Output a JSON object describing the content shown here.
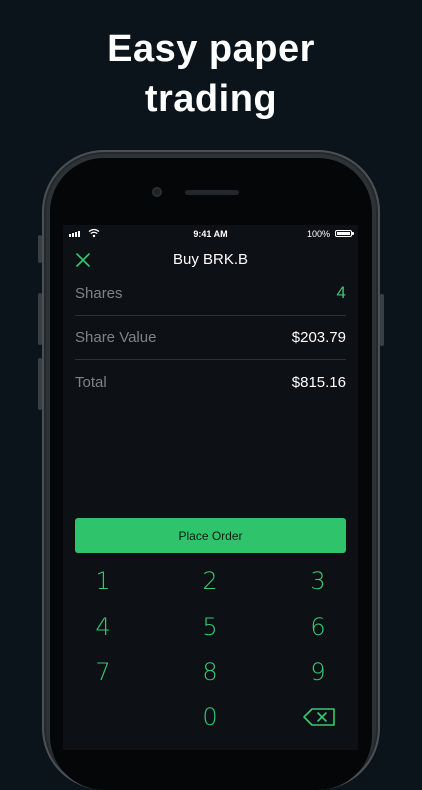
{
  "headline": {
    "line1": "Easy paper",
    "line2": "trading"
  },
  "status_bar": {
    "time": "9:41 AM",
    "battery": "100%"
  },
  "nav": {
    "title": "Buy BRK.B",
    "close_icon": "close-x-icon"
  },
  "order": {
    "rows": [
      {
        "label": "Shares",
        "value": "4"
      },
      {
        "label": "Share Value",
        "value": "$203.79"
      },
      {
        "label": "Total",
        "value": "$815.16"
      }
    ],
    "button_label": "Place Order"
  },
  "keypad": {
    "keys": [
      "1",
      "2",
      "3",
      "4",
      "5",
      "6",
      "7",
      "8",
      "9",
      "0"
    ],
    "backspace_icon": "backspace-icon"
  },
  "colors": {
    "accent": "#2fc46c",
    "background": "#0a141a",
    "screen": "#0d1014"
  }
}
